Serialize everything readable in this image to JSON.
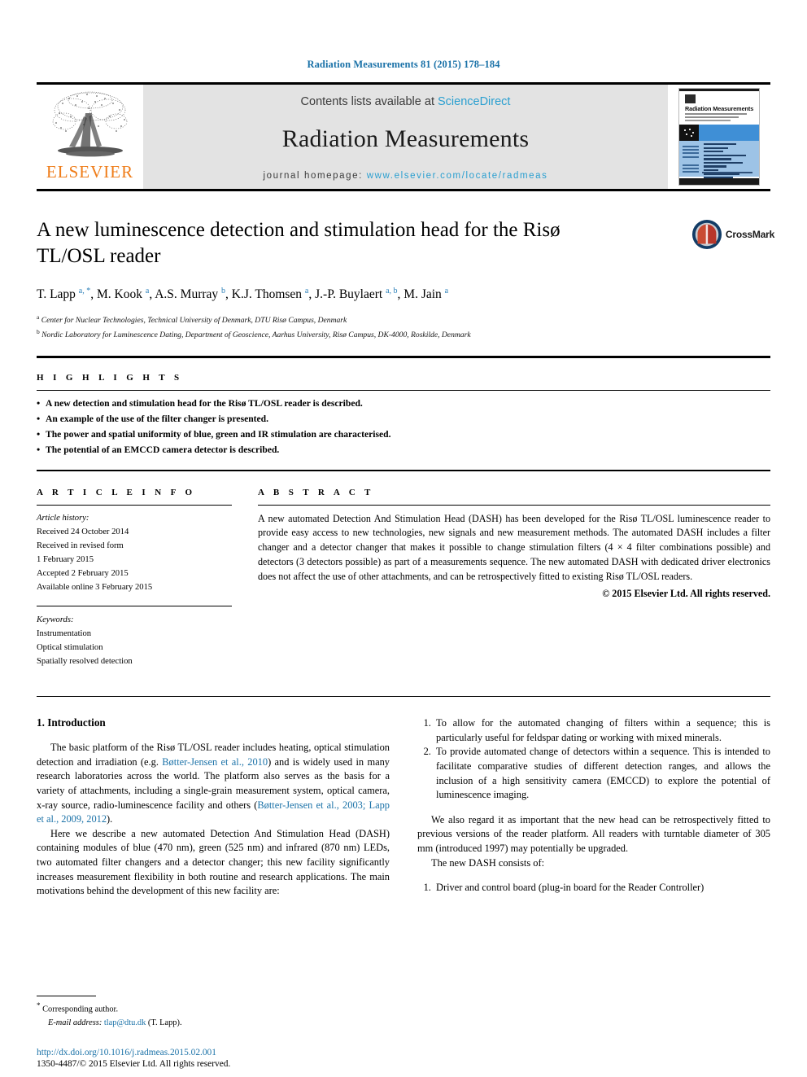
{
  "running_head": "Radiation Measurements 81 (2015) 178–184",
  "masthead": {
    "publisher_name": "ELSEVIER",
    "contents_prefix": "Contents lists available at",
    "contents_link": "ScienceDirect",
    "journal_title": "Radiation Measurements",
    "homepage_label": "journal homepage:",
    "homepage_url": "www.elsevier.com/locate/radmeas",
    "cover": {
      "title": "Radiation Measurements",
      "alt": "journal-cover-thumbnail"
    }
  },
  "article": {
    "title": "A new luminescence detection and stimulation head for the Risø TL/OSL reader",
    "authors": [
      {
        "name": "T. Lapp",
        "marks": "a, *"
      },
      {
        "name": "M. Kook",
        "marks": "a"
      },
      {
        "name": "A.S. Murray",
        "marks": "b"
      },
      {
        "name": "K.J. Thomsen",
        "marks": "a"
      },
      {
        "name": "J.-P. Buylaert",
        "marks": "a, b"
      },
      {
        "name": "M. Jain",
        "marks": "a"
      }
    ],
    "affiliations": [
      {
        "mark": "a",
        "text": "Center for Nuclear Technologies, Technical University of Denmark, DTU Risø Campus, Denmark"
      },
      {
        "mark": "b",
        "text": "Nordic Laboratory for Luminescence Dating, Department of Geoscience, Aarhus University, Risø Campus, DK-4000, Roskilde, Denmark"
      }
    ],
    "crossmark_label": "CrossMark"
  },
  "highlights": {
    "heading": "H I G H L I G H T S",
    "items": [
      "A new detection and stimulation head for the Risø TL/OSL reader is described.",
      "An example of the use of the filter changer is presented.",
      "The power and spatial uniformity of blue, green and IR stimulation are characterised.",
      "The potential of an EMCCD camera detector is described."
    ]
  },
  "article_info": {
    "heading": "A R T I C L E  I N F O",
    "history_label": "Article history:",
    "history": [
      "Received 24 October 2014",
      "Received in revised form",
      "1 February 2015",
      "Accepted 2 February 2015",
      "Available online 3 February 2015"
    ],
    "keywords_label": "Keywords:",
    "keywords": [
      "Instrumentation",
      "Optical stimulation",
      "Spatially resolved detection"
    ]
  },
  "abstract": {
    "heading": "A B S T R A C T",
    "text": "A new automated Detection And Stimulation Head (DASH) has been developed for the Risø TL/OSL luminescence reader to provide easy access to new technologies, new signals and new measurement methods. The automated DASH includes a filter changer and a detector changer that makes it possible to change stimulation filters (4 × 4 filter combinations possible) and detectors (3 detectors possible) as part of a measurements sequence. The new automated DASH with dedicated driver electronics does not affect the use of other attachments, and can be retrospectively fitted to existing Risø TL/OSL readers.",
    "copyright": "© 2015 Elsevier Ltd. All rights reserved."
  },
  "body": {
    "section_number_title": "1. Introduction",
    "left_paragraph_1_a": "The basic platform of the Risø TL/OSL reader includes heating, optical stimulation detection and irradiation (e.g. ",
    "left_ref_1": "Bøtter-Jensen et al., 2010",
    "left_paragraph_1_b": ") and is widely used in many research laboratories across the world. The platform also serves as the basis for a variety of attachments, including a single-grain measurement system, optical camera, x-ray source, radio-luminescence facility and others (",
    "left_ref_2": "Bøtter-Jensen et al., 2003; Lapp et al., 2009, 2012",
    "left_paragraph_1_c": ").",
    "left_paragraph_2": "Here we describe a new automated Detection And Stimulation Head (DASH) containing modules of blue (470 nm), green (525 nm) and infrared (870 nm) LEDs, two automated filter changers and a detector changer; this new facility significantly increases measurement flexibility in both routine and research applications. The main motivations behind the development of this new facility are:",
    "motivations": [
      "To allow for the automated changing of filters within a sequence; this is particularly useful for feldspar dating or working with mixed minerals.",
      "To provide automated change of detectors within a sequence. This is intended to facilitate comparative studies of different detection ranges, and allows the inclusion of a high sensitivity camera (EMCCD) to explore the potential of luminescence imaging."
    ],
    "right_paragraph_1": "We also regard it as important that the new head can be retrospectively fitted to previous versions of the reader platform. All readers with turntable diameter of 305 mm (introduced 1997) may potentially be upgraded.",
    "right_paragraph_2": "The new DASH consists of:",
    "dash_parts": [
      "Driver and control board (plug-in board for the Reader Controller)"
    ]
  },
  "footer": {
    "corresponding_author": "Corresponding author.",
    "email_label": "E-mail address:",
    "email": "tlap@dtu.dk",
    "email_owner": "(T. Lapp).",
    "doi": "http://dx.doi.org/10.1016/j.radmeas.2015.02.001",
    "issn_line": "1350-4487/© 2015 Elsevier Ltd. All rights reserved."
  },
  "colors": {
    "link_blue": "#1b72a8",
    "sciencedirect_blue": "#2a9fd0",
    "elsevier_orange": "#ef7d1a",
    "banner_gray": "#e3e3e3"
  }
}
